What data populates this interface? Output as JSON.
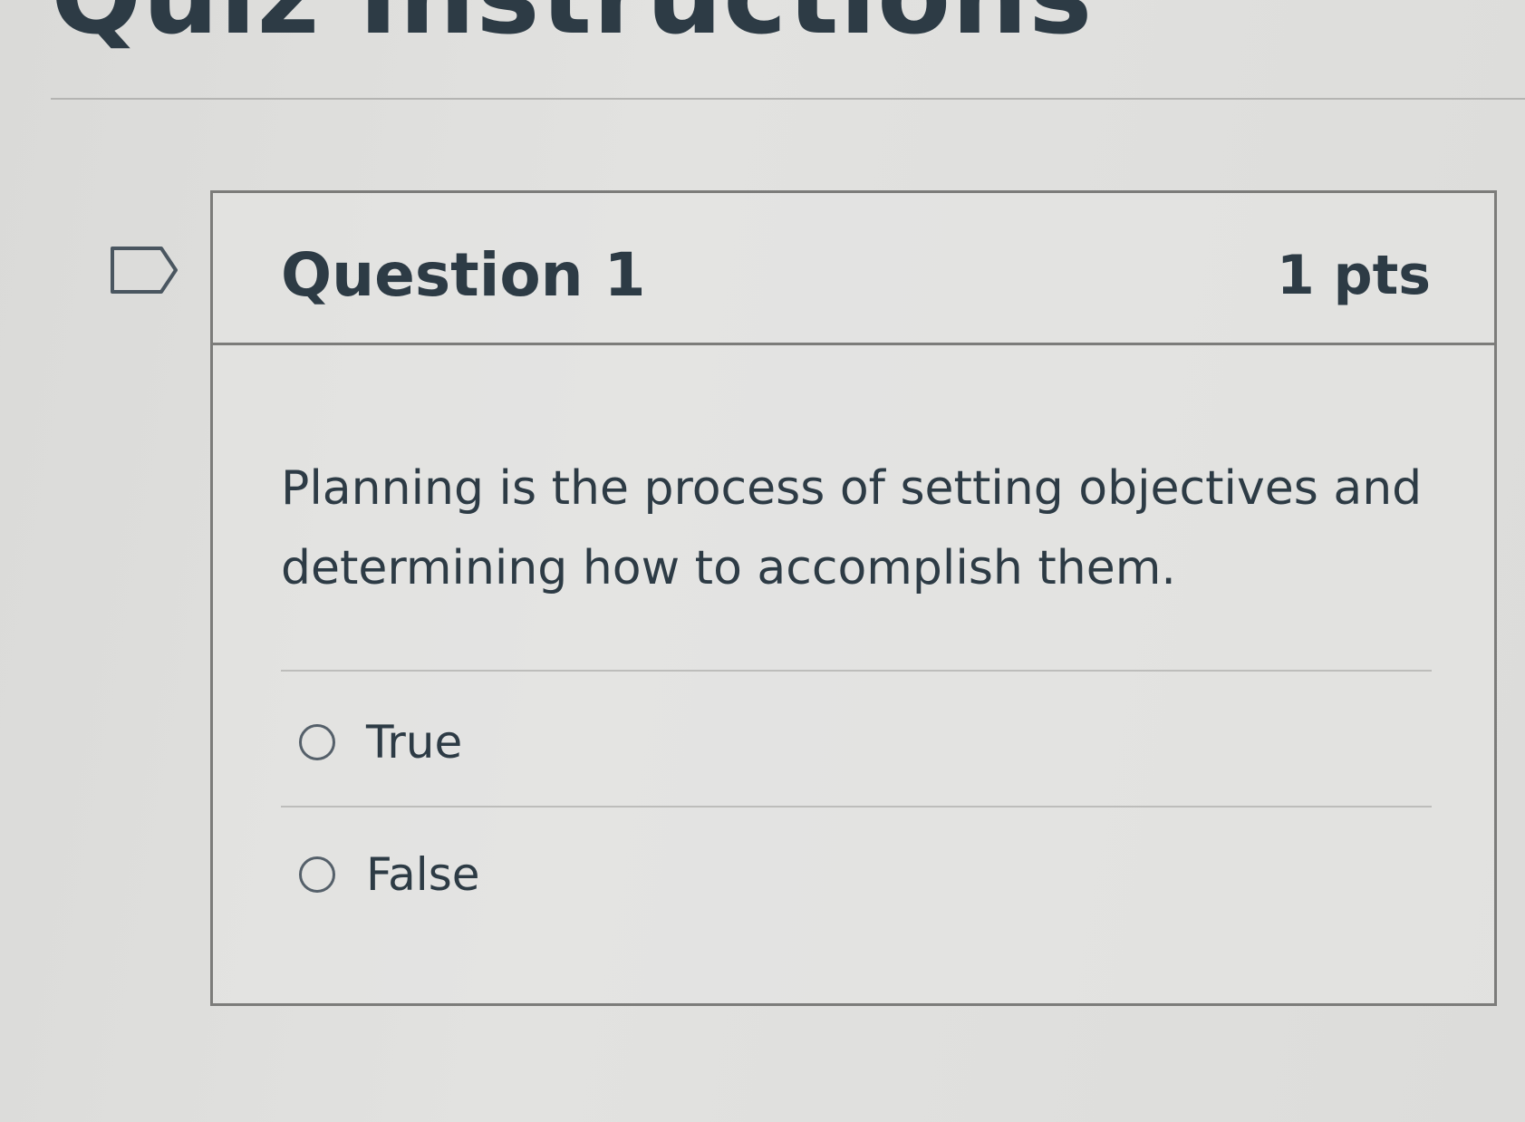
{
  "page": {
    "title": "Quiz Instructions"
  },
  "question": {
    "name": "Question 1",
    "points": "1 pts",
    "text": "Planning is the process of setting objectives and determining how to accomplish them.",
    "answers": [
      {
        "label": "True"
      },
      {
        "label": "False"
      }
    ]
  },
  "icons": {
    "flag": "flag-question-icon",
    "radio": "radio-button-icon"
  },
  "colors": {
    "text": "#2d3b45",
    "border": "#7c7c7a",
    "background": "#dedede"
  }
}
